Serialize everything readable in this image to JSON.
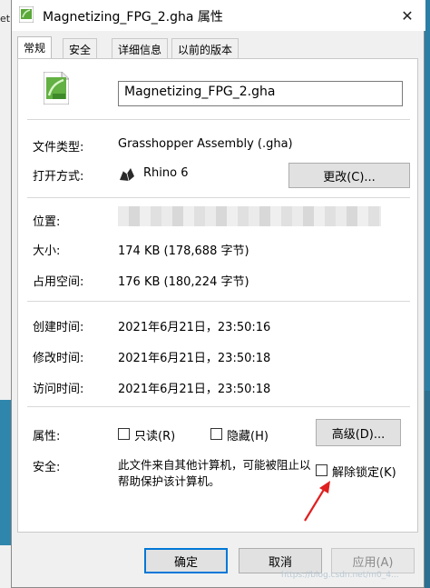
{
  "background": {
    "left_fragment": "et"
  },
  "window": {
    "title": "Magnetizing_FPG_2.gha 属性",
    "close_glyph": "✕"
  },
  "tabs": [
    {
      "label": "常规",
      "active": true
    },
    {
      "label": "安全",
      "active": false
    },
    {
      "label": "详细信息",
      "active": false
    },
    {
      "label": "以前的版本",
      "active": false
    }
  ],
  "general": {
    "file_name": "Magnetizing_FPG_2.gha",
    "file_type_label": "文件类型:",
    "file_type_value": "Grasshopper Assembly (.gha)",
    "opens_with_label": "打开方式:",
    "opens_with_value": "Rhino 6",
    "change_button": "更改(C)...",
    "location_label": "位置:",
    "size_label": "大小:",
    "size_value": "174 KB (178,688 字节)",
    "size_on_disk_label": "占用空间:",
    "size_on_disk_value": "176 KB (180,224 字节)",
    "created_label": "创建时间:",
    "created_value": "2021年6月21日，23:50:16",
    "modified_label": "修改时间:",
    "modified_value": "2021年6月21日，23:50:18",
    "accessed_label": "访问时间:",
    "accessed_value": "2021年6月21日，23:50:18",
    "attributes_label": "属性:",
    "readonly_label": "只读(R)",
    "hidden_label": "隐藏(H)",
    "advanced_button": "高级(D)...",
    "security_label": "安全:",
    "security_text": "此文件来自其他计算机，可能被阻止以帮助保护该计算机。",
    "unblock_label": "解除锁定(K)"
  },
  "footer": {
    "ok_button": "确定",
    "cancel_button": "取消",
    "apply_button": "应用(A)"
  },
  "icons": {
    "file": "gha-file-icon",
    "rhino": "rhino-app-icon",
    "arrow_color": "#e02020"
  },
  "watermark": "https://blog.csdn.net/m0_4..."
}
